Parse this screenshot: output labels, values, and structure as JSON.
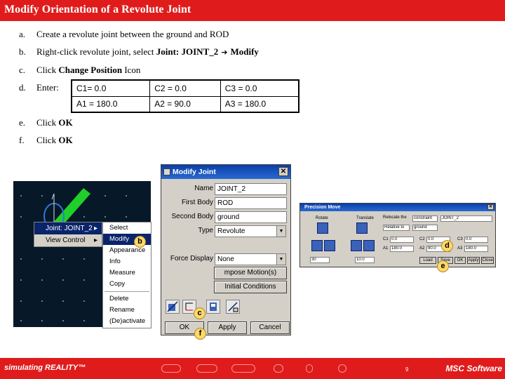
{
  "page": {
    "title": "Modify Orientation of a Revolute Joint"
  },
  "steps": [
    {
      "letter": "a.",
      "text": "Create a revolute joint between the ground and ROD"
    },
    {
      "letter": "b.",
      "text_pre": "Right-click revolute joint, select ",
      "bold1": "Joint: JOINT_2",
      "arrow": "➔",
      "bold2": "Modify"
    },
    {
      "letter": "c.",
      "text_pre": "Click ",
      "bold": "Change Position",
      "text_post": " Icon"
    },
    {
      "letter": "d.",
      "text": "Enter:"
    },
    {
      "letter": "e.",
      "text_pre": "Click ",
      "bold": "OK"
    },
    {
      "letter": "f.",
      "text_pre": "Click ",
      "bold": "OK"
    }
  ],
  "values_table": [
    [
      "C1= 0.0",
      "C2 = 0.0",
      "C3 = 0.0"
    ],
    [
      "A1 = 180.0",
      "A2 = 90.0",
      "A3 = 180.0"
    ]
  ],
  "context_menu": {
    "items": [
      {
        "label": "Joint: JOINT_2",
        "arrow": "▸"
      },
      {
        "label": "View Control",
        "arrow": "▸"
      }
    ],
    "submenu": [
      "Select",
      "Modify",
      "Appearance",
      "Info",
      "Measure",
      "Copy",
      "Delete",
      "Rename",
      "(De)activate"
    ]
  },
  "modify_joint": {
    "title": "Modify Joint",
    "close": "✕",
    "name_label": "Name",
    "name_value": "JOINT_2",
    "first_body_label": "First Body",
    "first_body_value": "ROD",
    "second_body_label": "Second Body",
    "second_body_value": "ground",
    "type_label": "Type",
    "type_value": "Revolute",
    "force_display_label": "Force Display",
    "force_display_value": "None",
    "impose_motion_label": "mpose Motion(s)",
    "initial_conditions_label": "Initial Conditions",
    "ok_label": "OK",
    "apply_label": "Apply",
    "cancel_label": "Cancel"
  },
  "position_now": {
    "title": "Precision Move",
    "close": "✕",
    "rotate_label": "Rotate",
    "translate_label": "Translate",
    "relocate_label": "Relocate the",
    "relocate_value": "constraint",
    "relocate_target": "JOINT_2",
    "about_value": "Relative to",
    "about_target": "ground",
    "c1": "C1",
    "c1v": "0.0",
    "c2": "C2",
    "c2v": "0.0",
    "c3": "C3",
    "c3v": "0.0",
    "a1": "A1",
    "a1v": "180.0",
    "a2": "A2",
    "a2v": "90.0",
    "a3": "A3",
    "a3v": "180.0",
    "step1": "30",
    "step2": "10.0",
    "load_label": "Load",
    "save_label": "Save",
    "ok_label": "OK",
    "apply_label": "Apply",
    "close_label": "Close"
  },
  "callouts": {
    "b": "b",
    "c": "c",
    "d": "d",
    "e": "e",
    "f": "f"
  },
  "footer": {
    "left": "simulating REALITY™",
    "page_number": "9",
    "right": "MSC Software"
  },
  "colors": {
    "brand_red": "#e01b1b",
    "callout_fill": "#ffd86a",
    "titlebar_blue": "#0a3fa8",
    "viewport_bg": "#071828",
    "joint_green": "#1fd02a"
  }
}
